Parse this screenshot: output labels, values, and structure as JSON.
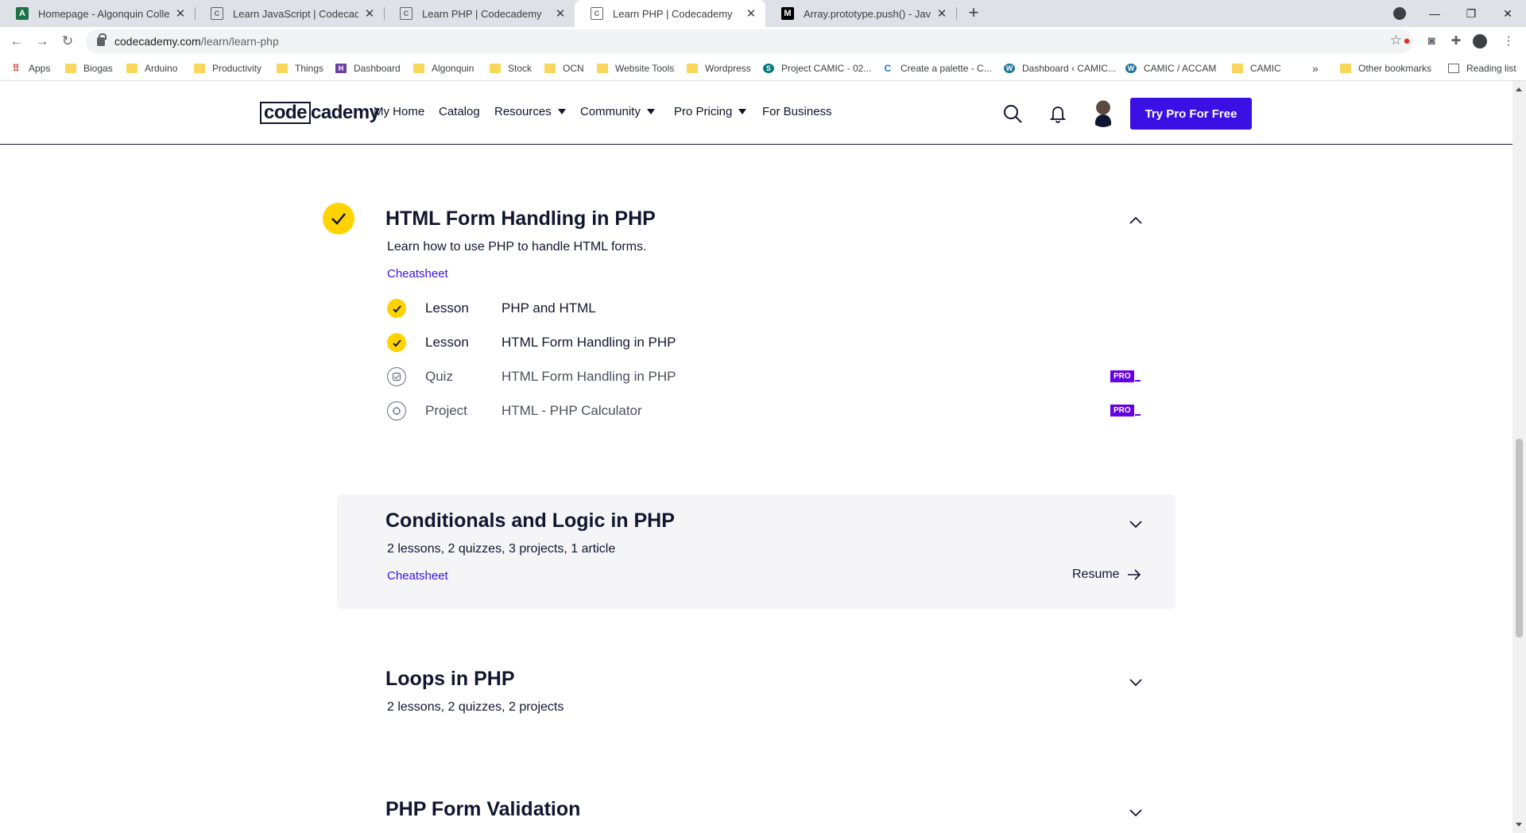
{
  "browser": {
    "tabs": [
      {
        "title": "Homepage - Algonquin College",
        "favicon": "algonquin-icon",
        "active": false
      },
      {
        "title": "Learn JavaScript | Codecademy",
        "favicon": "codecademy-icon",
        "active": false
      },
      {
        "title": "Learn PHP | Codecademy",
        "favicon": "codecademy-icon",
        "active": false
      },
      {
        "title": "Learn PHP | Codecademy",
        "favicon": "codecademy-icon",
        "active": true
      },
      {
        "title": "Array.prototype.push() - JavaScri",
        "favicon": "mdn-icon",
        "active": false
      }
    ],
    "url_host": "codecademy.com",
    "url_path": "/learn/learn-php",
    "bookmarks": [
      "Apps",
      "Biogas",
      "Arduino",
      "Productivity",
      "Things",
      "Dashboard",
      "Algonquin",
      "Stock",
      "OCN",
      "Website Tools",
      "Wordpress",
      "Project CAMIC - 02...",
      "Create a palette - C...",
      "Dashboard ‹ CAMIC...",
      "CAMIC / ACCAM",
      "CAMIC"
    ],
    "bookmarks_overflow": "»",
    "other_bookmarks": "Other bookmarks",
    "reading_list": "Reading list"
  },
  "header": {
    "logo_left": "code",
    "logo_right": "cademy",
    "nav": [
      "My Home",
      "Catalog",
      "Resources",
      "Community",
      "Pro Pricing",
      "For Business"
    ],
    "cta": "Try Pro For Free"
  },
  "modules": [
    {
      "title": "HTML Form Handling in PHP",
      "description": "Learn how to use PHP to handle HTML forms.",
      "cheatsheet": "Cheatsheet",
      "expanded": true,
      "completed": true,
      "items": [
        {
          "kind": "Lesson",
          "name": "PHP and HTML",
          "done": true,
          "pro": ""
        },
        {
          "kind": "Lesson",
          "name": "HTML Form Handling in PHP",
          "done": true,
          "pro": ""
        },
        {
          "kind": "Quiz",
          "name": "HTML Form Handling in PHP",
          "done": false,
          "pro": "PRO"
        },
        {
          "kind": "Project",
          "name": "HTML - PHP Calculator",
          "done": false,
          "pro": "PRO"
        }
      ]
    },
    {
      "title": "Conditionals and Logic in PHP",
      "summary": "2 lessons, 2 quizzes, 3 projects, 1 article",
      "cheatsheet": "Cheatsheet",
      "resume": "Resume",
      "expanded": false
    },
    {
      "title": "Loops in PHP",
      "summary": "2 lessons, 2 quizzes, 2 projects",
      "expanded": false
    },
    {
      "title": "PHP Form Validation",
      "expanded": false
    }
  ],
  "colors": {
    "brand_purple": "#3a10e5",
    "check_yellow": "#ffd300",
    "pro_badge": "#6400e4",
    "text_navy": "#10162f"
  }
}
